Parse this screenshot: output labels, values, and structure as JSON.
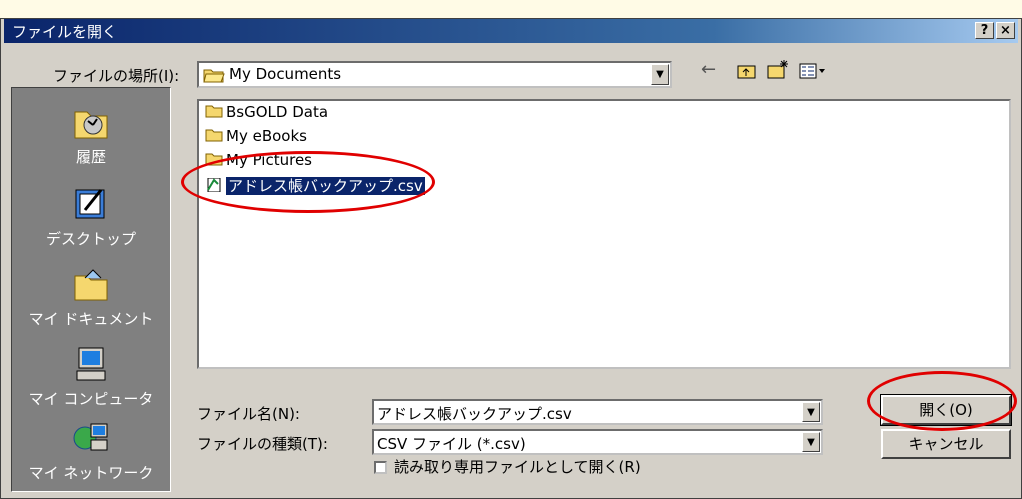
{
  "window": {
    "title": "ファイルを開く",
    "help_btn": "?",
    "close_btn": "×"
  },
  "lookin": {
    "label": "ファイルの場所(I):",
    "value": "My Documents"
  },
  "toolbar": {
    "back": "←",
    "up": "folder-up",
    "new_folder": "new-folder",
    "views": "views-menu"
  },
  "places": [
    {
      "label": "履歴",
      "icon": "history-icon"
    },
    {
      "label": "デスクトップ",
      "icon": "desktop-icon"
    },
    {
      "label": "マイ ドキュメント",
      "icon": "my-documents-icon"
    },
    {
      "label": "マイ コンピュータ",
      "icon": "my-computer-icon"
    },
    {
      "label": "マイ ネットワーク",
      "icon": "my-network-icon"
    }
  ],
  "files": [
    {
      "name": "BsGOLD Data",
      "icon": "folder-icon"
    },
    {
      "name": "My eBooks",
      "icon": "folder-icon"
    },
    {
      "name": "My Pictures",
      "icon": "folder-icon"
    },
    {
      "name": "アドレス帳バックアップ.csv",
      "icon": "csv-file-icon",
      "selected": true
    }
  ],
  "filename": {
    "label": "ファイル名(N):",
    "value": "アドレス帳バックアップ.csv"
  },
  "filetype": {
    "label": "ファイルの種類(T):",
    "value": "CSV ファイル (*.csv)"
  },
  "readonly": {
    "label": "読み取り専用ファイルとして開く(R)",
    "checked": false
  },
  "buttons": {
    "open": "開く(O)",
    "cancel": "キャンセル"
  },
  "colors": {
    "titlebar": "#0a246a",
    "annotation": "#e00000",
    "selection": "#0a246a"
  }
}
